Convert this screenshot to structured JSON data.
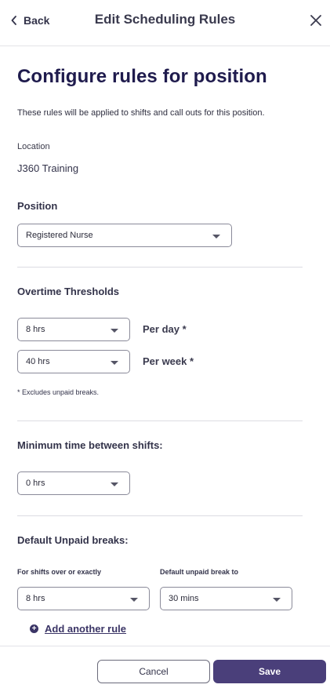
{
  "header": {
    "back_label": "Back",
    "title": "Edit Scheduling Rules",
    "back_icon": "chevron-left-icon",
    "close_icon": "close-icon"
  },
  "main": {
    "heading": "Configure rules for position",
    "description": "These rules will be applied to shifts and call outs for this position.",
    "location_label": "Location",
    "location_value": "J360 Training",
    "position_label": "Position",
    "position_value": "Registered Nurse"
  },
  "overtime": {
    "title": "Overtime Thresholds",
    "per_day_value": "8 hrs",
    "per_day_label": "Per day *",
    "per_week_value": "40 hrs",
    "per_week_label": "Per week *",
    "note": "* Excludes unpaid breaks."
  },
  "min_time": {
    "title": "Minimum time between shifts:",
    "value": "0 hrs"
  },
  "breaks": {
    "title": "Default Unpaid breaks:",
    "col1_label": "For shifts over or exactly",
    "col2_label": "Default unpaid break to",
    "shift_value": "8 hrs",
    "break_value": "30 mins",
    "add_rule_label": "Add another rule",
    "add_icon": "plus-circle-icon"
  },
  "footer": {
    "cancel_label": "Cancel",
    "save_label": "Save"
  },
  "colors": {
    "primary": "#4a3f7a",
    "heading": "#1f1b4d"
  }
}
